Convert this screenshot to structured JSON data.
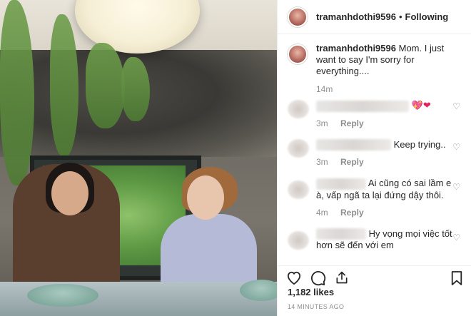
{
  "post": {
    "username": "tramanhdothi9596",
    "dot": "•",
    "following": "Following"
  },
  "caption": {
    "username": "tramanhdothi9596",
    "text": "Mom. I just want to say I'm sorry for everything....",
    "time": "14m"
  },
  "comments": [
    {
      "text": "",
      "emoji_1": "💖",
      "emoji_2": "❤",
      "time": "3m",
      "reply": "Reply"
    },
    {
      "text": "Keep trying..",
      "time": "3m",
      "reply": "Reply"
    },
    {
      "text": "Ai cũng có sai lầm e à, vấp ngã ta lại đứng dậy thôi.",
      "time": "4m",
      "reply": "Reply"
    },
    {
      "text": "Hy vọng mọi việc tốt hơn sẽ đến với em",
      "time": "",
      "reply": ""
    }
  ],
  "footer": {
    "likes": "1,182 likes",
    "time": "14 MINUTES AGO"
  },
  "icons": {
    "heart": "heart-icon",
    "comment": "comment-icon",
    "share": "share-icon",
    "bookmark": "bookmark-icon"
  }
}
